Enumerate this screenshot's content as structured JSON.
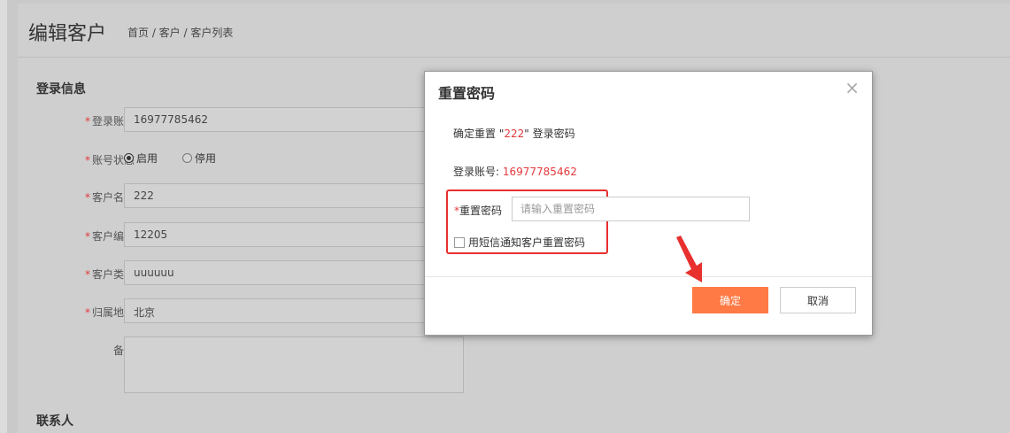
{
  "page": {
    "title": "编辑客户",
    "breadcrumb": "首页 / 客户 / 客户列表"
  },
  "form": {
    "section_login": "登录信息",
    "section_contact": "联系人",
    "required_mark": "*",
    "account_label": "登录账号",
    "account_value": "16977785462",
    "status_label": "账号状态",
    "status_enabled": "启用",
    "status_disabled": "停用",
    "status_selected": "启用",
    "name_label": "客户名称",
    "name_value": "222",
    "code_label": "客户编号",
    "code_value": "12205",
    "type_label": "客户类型",
    "type_value": "uuuuuu",
    "region_label": "归属地区",
    "region_value": "北京",
    "remark_label": "备注",
    "remark_value": ""
  },
  "modal": {
    "title": "重置密码",
    "close_icon": "×",
    "confirm_prefix": "确定重置 \"",
    "confirm_name": "222",
    "confirm_suffix": "\" 登录密码",
    "account_prefix": "登录账号: ",
    "account_value": "16977785462",
    "password_required": "*",
    "password_label": "重置密码",
    "password_placeholder": "请输入重置密码",
    "password_value": "",
    "sms_label": "用短信通知客户重置密码",
    "sms_checked": false,
    "ok_label": "确定",
    "cancel_label": "取消"
  },
  "colors": {
    "accent": "#ff7a45",
    "highlight_red": "#e8302e",
    "text_red": "#e4393c",
    "overlay_gray": "#cfcfcf"
  }
}
